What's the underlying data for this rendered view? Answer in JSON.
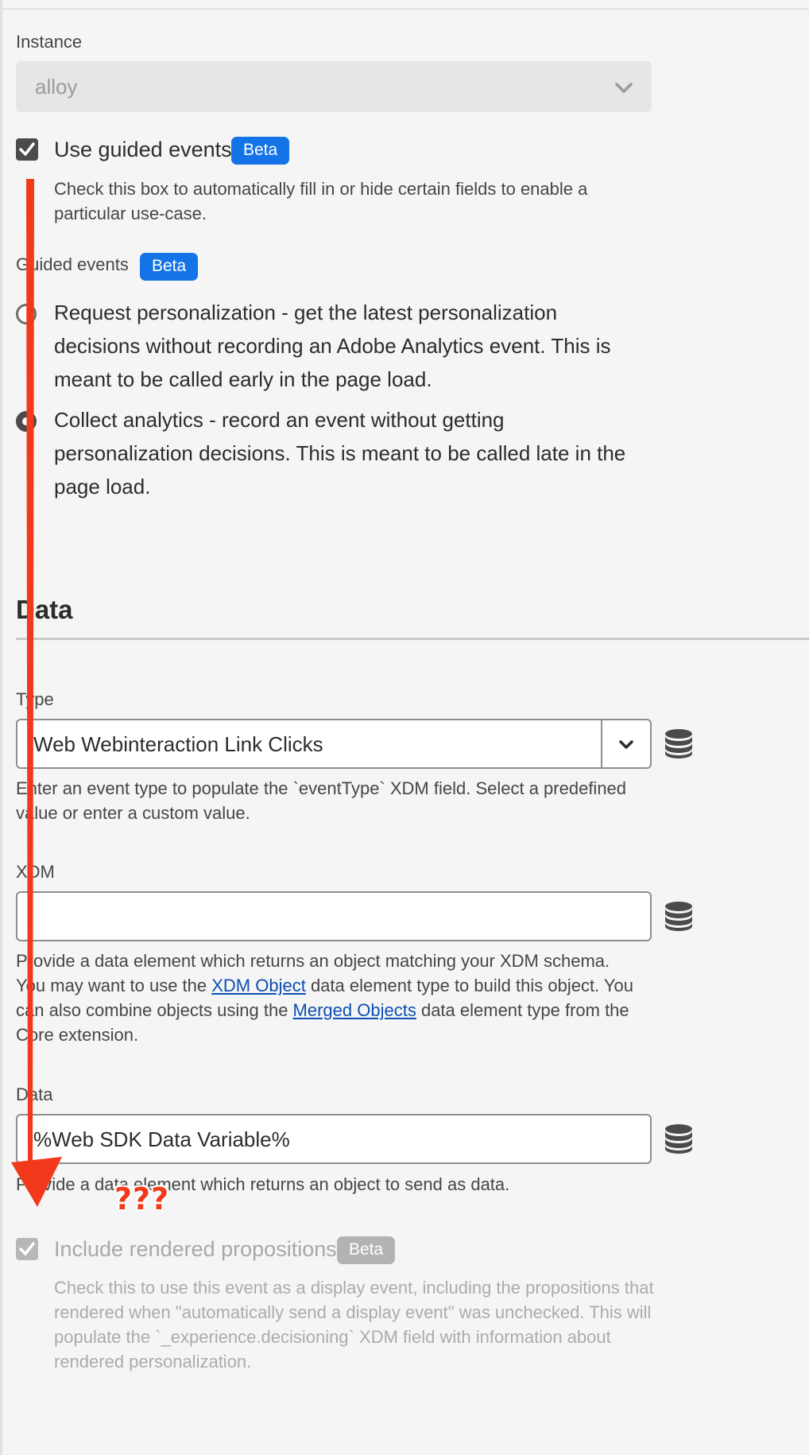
{
  "instance": {
    "label": "Instance",
    "value": "alloy"
  },
  "guided_events_toggle": {
    "label": "Use guided events",
    "badge": "Beta",
    "checked": true,
    "help_line1": "Check this box to automatically fill in or hide certain fields to enable a",
    "help_line2": "particular use-case."
  },
  "guided_events": {
    "label": "Guided events",
    "badge": "Beta",
    "options": [
      {
        "lines": [
          "Request personalization - get the latest personalization",
          "decisions without recording an Adobe Analytics event. This is",
          "meant to be called early in the page load."
        ],
        "selected": false
      },
      {
        "lines": [
          "Collect analytics - record an event without getting",
          "personalization decisions. This is meant to be called late in the",
          "page load."
        ],
        "selected": true
      }
    ]
  },
  "data_section": {
    "heading": "Data"
  },
  "type_field": {
    "label": "Type",
    "value": "Web Webinteraction Link Clicks",
    "help_line1": "Enter an event type to populate the `eventType` XDM field. Select a predefined",
    "help_line2": "value or enter a custom value."
  },
  "xdm_field": {
    "label": "XDM",
    "value": "",
    "help_line1": "Provide a data element which returns an object matching your XDM schema.",
    "help_line2_pre": "You may want to use the ",
    "help_link1": "XDM Object",
    "help_line2_post": " data element type to build this object. You",
    "help_line3_pre": "can also combine objects using the ",
    "help_link2": "Merged Objects",
    "help_line3_post": " data element type from the",
    "help_line4": "Core extension."
  },
  "data_field": {
    "label": "Data",
    "value": "%Web SDK Data Variable%",
    "help": "Provide a data element which returns an object to send as data."
  },
  "rendered_propositions": {
    "label": "Include rendered propositions",
    "badge": "Beta",
    "checked": true,
    "disabled": true,
    "help_lines": [
      "Check this to use this event as a display event, including the propositions that",
      "rendered when \"automatically send a display event\" was unchecked. This will",
      "populate the `_experience.decisioning` XDM field with information about",
      "rendered personalization."
    ]
  },
  "annotation": {
    "text": "???",
    "color": "#f23a1a"
  },
  "colors": {
    "accent_blue": "#1473e6",
    "link_blue": "#0d4fb3",
    "annotation_red": "#f23a1a"
  },
  "icons": {
    "chevron": "chevron-down-icon",
    "data_element": "database-icon",
    "check": "checkmark-icon"
  }
}
